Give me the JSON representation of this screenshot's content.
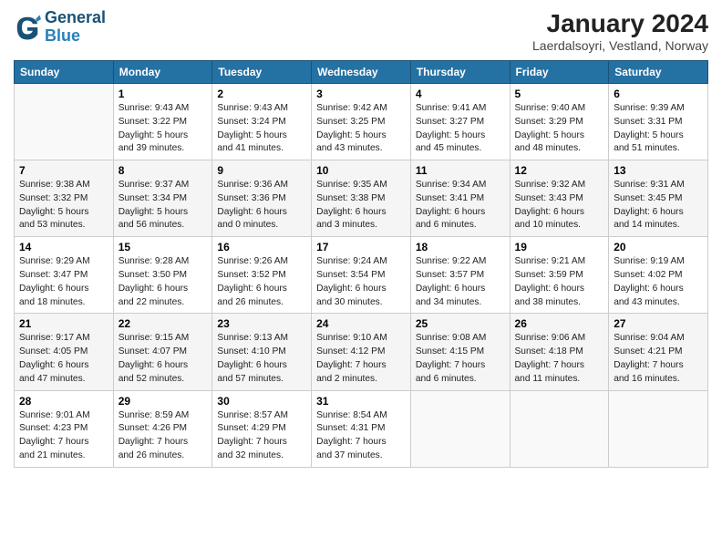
{
  "logo": {
    "line1": "General",
    "line2": "Blue"
  },
  "title": "January 2024",
  "subtitle": "Laerdalsoyri, Vestland, Norway",
  "days_of_week": [
    "Sunday",
    "Monday",
    "Tuesday",
    "Wednesday",
    "Thursday",
    "Friday",
    "Saturday"
  ],
  "weeks": [
    [
      {
        "num": "",
        "info": ""
      },
      {
        "num": "1",
        "info": "Sunrise: 9:43 AM\nSunset: 3:22 PM\nDaylight: 5 hours\nand 39 minutes."
      },
      {
        "num": "2",
        "info": "Sunrise: 9:43 AM\nSunset: 3:24 PM\nDaylight: 5 hours\nand 41 minutes."
      },
      {
        "num": "3",
        "info": "Sunrise: 9:42 AM\nSunset: 3:25 PM\nDaylight: 5 hours\nand 43 minutes."
      },
      {
        "num": "4",
        "info": "Sunrise: 9:41 AM\nSunset: 3:27 PM\nDaylight: 5 hours\nand 45 minutes."
      },
      {
        "num": "5",
        "info": "Sunrise: 9:40 AM\nSunset: 3:29 PM\nDaylight: 5 hours\nand 48 minutes."
      },
      {
        "num": "6",
        "info": "Sunrise: 9:39 AM\nSunset: 3:31 PM\nDaylight: 5 hours\nand 51 minutes."
      }
    ],
    [
      {
        "num": "7",
        "info": "Sunrise: 9:38 AM\nSunset: 3:32 PM\nDaylight: 5 hours\nand 53 minutes."
      },
      {
        "num": "8",
        "info": "Sunrise: 9:37 AM\nSunset: 3:34 PM\nDaylight: 5 hours\nand 56 minutes."
      },
      {
        "num": "9",
        "info": "Sunrise: 9:36 AM\nSunset: 3:36 PM\nDaylight: 6 hours\nand 0 minutes."
      },
      {
        "num": "10",
        "info": "Sunrise: 9:35 AM\nSunset: 3:38 PM\nDaylight: 6 hours\nand 3 minutes."
      },
      {
        "num": "11",
        "info": "Sunrise: 9:34 AM\nSunset: 3:41 PM\nDaylight: 6 hours\nand 6 minutes."
      },
      {
        "num": "12",
        "info": "Sunrise: 9:32 AM\nSunset: 3:43 PM\nDaylight: 6 hours\nand 10 minutes."
      },
      {
        "num": "13",
        "info": "Sunrise: 9:31 AM\nSunset: 3:45 PM\nDaylight: 6 hours\nand 14 minutes."
      }
    ],
    [
      {
        "num": "14",
        "info": "Sunrise: 9:29 AM\nSunset: 3:47 PM\nDaylight: 6 hours\nand 18 minutes."
      },
      {
        "num": "15",
        "info": "Sunrise: 9:28 AM\nSunset: 3:50 PM\nDaylight: 6 hours\nand 22 minutes."
      },
      {
        "num": "16",
        "info": "Sunrise: 9:26 AM\nSunset: 3:52 PM\nDaylight: 6 hours\nand 26 minutes."
      },
      {
        "num": "17",
        "info": "Sunrise: 9:24 AM\nSunset: 3:54 PM\nDaylight: 6 hours\nand 30 minutes."
      },
      {
        "num": "18",
        "info": "Sunrise: 9:22 AM\nSunset: 3:57 PM\nDaylight: 6 hours\nand 34 minutes."
      },
      {
        "num": "19",
        "info": "Sunrise: 9:21 AM\nSunset: 3:59 PM\nDaylight: 6 hours\nand 38 minutes."
      },
      {
        "num": "20",
        "info": "Sunrise: 9:19 AM\nSunset: 4:02 PM\nDaylight: 6 hours\nand 43 minutes."
      }
    ],
    [
      {
        "num": "21",
        "info": "Sunrise: 9:17 AM\nSunset: 4:05 PM\nDaylight: 6 hours\nand 47 minutes."
      },
      {
        "num": "22",
        "info": "Sunrise: 9:15 AM\nSunset: 4:07 PM\nDaylight: 6 hours\nand 52 minutes."
      },
      {
        "num": "23",
        "info": "Sunrise: 9:13 AM\nSunset: 4:10 PM\nDaylight: 6 hours\nand 57 minutes."
      },
      {
        "num": "24",
        "info": "Sunrise: 9:10 AM\nSunset: 4:12 PM\nDaylight: 7 hours\nand 2 minutes."
      },
      {
        "num": "25",
        "info": "Sunrise: 9:08 AM\nSunset: 4:15 PM\nDaylight: 7 hours\nand 6 minutes."
      },
      {
        "num": "26",
        "info": "Sunrise: 9:06 AM\nSunset: 4:18 PM\nDaylight: 7 hours\nand 11 minutes."
      },
      {
        "num": "27",
        "info": "Sunrise: 9:04 AM\nSunset: 4:21 PM\nDaylight: 7 hours\nand 16 minutes."
      }
    ],
    [
      {
        "num": "28",
        "info": "Sunrise: 9:01 AM\nSunset: 4:23 PM\nDaylight: 7 hours\nand 21 minutes."
      },
      {
        "num": "29",
        "info": "Sunrise: 8:59 AM\nSunset: 4:26 PM\nDaylight: 7 hours\nand 26 minutes."
      },
      {
        "num": "30",
        "info": "Sunrise: 8:57 AM\nSunset: 4:29 PM\nDaylight: 7 hours\nand 32 minutes."
      },
      {
        "num": "31",
        "info": "Sunrise: 8:54 AM\nSunset: 4:31 PM\nDaylight: 7 hours\nand 37 minutes."
      },
      {
        "num": "",
        "info": ""
      },
      {
        "num": "",
        "info": ""
      },
      {
        "num": "",
        "info": ""
      }
    ]
  ]
}
